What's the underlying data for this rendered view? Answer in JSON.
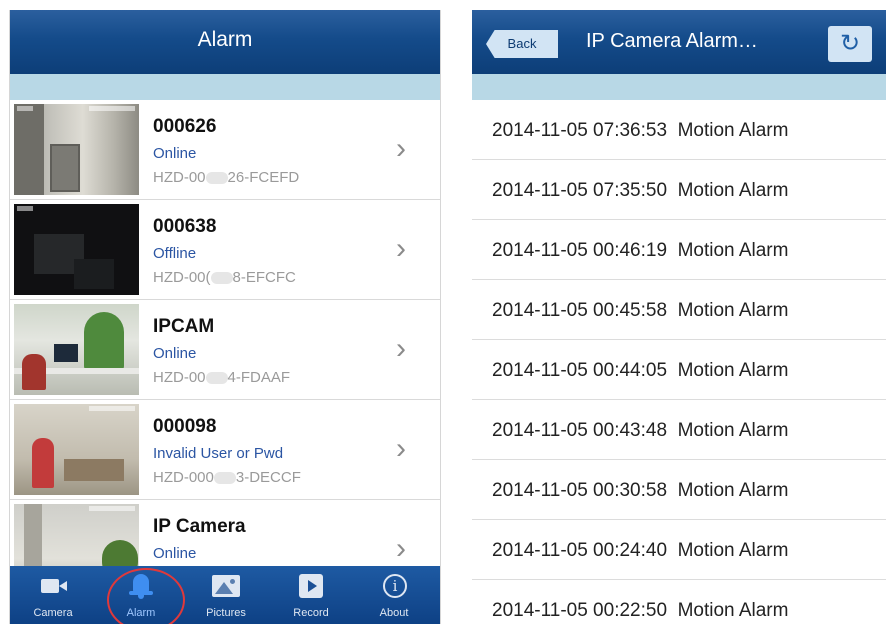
{
  "left": {
    "title": "Alarm",
    "cameras": [
      {
        "name": "000626",
        "status": "Online",
        "id_prefix": "HZD-00",
        "id_suffix": "26-FCEFD"
      },
      {
        "name": "000638",
        "status": "Offline",
        "id_prefix": "HZD-00(",
        "id_suffix": "8-EFCFC"
      },
      {
        "name": "IPCAM",
        "status": "Online",
        "id_prefix": "HZD-00",
        "id_suffix": "4-FDAAF"
      },
      {
        "name": "000098",
        "status": "Invalid User or Pwd",
        "id_prefix": "HZD-000",
        "id_suffix": "3-DECCF"
      },
      {
        "name": "IP Camera",
        "status": "Online",
        "id_prefix": "",
        "id_suffix": ""
      }
    ],
    "tabs": [
      {
        "label": "Camera",
        "icon": "camera-icon"
      },
      {
        "label": "Alarm",
        "icon": "bell-icon"
      },
      {
        "label": "Pictures",
        "icon": "pictures-icon"
      },
      {
        "label": "Record",
        "icon": "record-icon"
      },
      {
        "label": "About",
        "icon": "info-icon"
      }
    ],
    "chevron": "›",
    "active_tab": "Alarm",
    "highlight_color": "#e0393b"
  },
  "right": {
    "back_label": "Back",
    "title": "IP Camera Alarm…",
    "refresh_glyph": "↻",
    "alarms": [
      "2014-11-05 07:36:53  Motion Alarm",
      "2014-11-05 07:35:50  Motion Alarm",
      "2014-11-05 00:46:19  Motion Alarm",
      "2014-11-05 00:45:58  Motion Alarm",
      "2014-11-05 00:44:05  Motion Alarm",
      "2014-11-05 00:43:48  Motion Alarm",
      "2014-11-05 00:30:58  Motion Alarm",
      "2014-11-05 00:24:40  Motion Alarm",
      "2014-11-05 00:22:50  Motion Alarm"
    ]
  },
  "colors": {
    "navbar": "#144b8a",
    "subbar": "#b8d8e6",
    "status_text": "#2b55a3"
  }
}
